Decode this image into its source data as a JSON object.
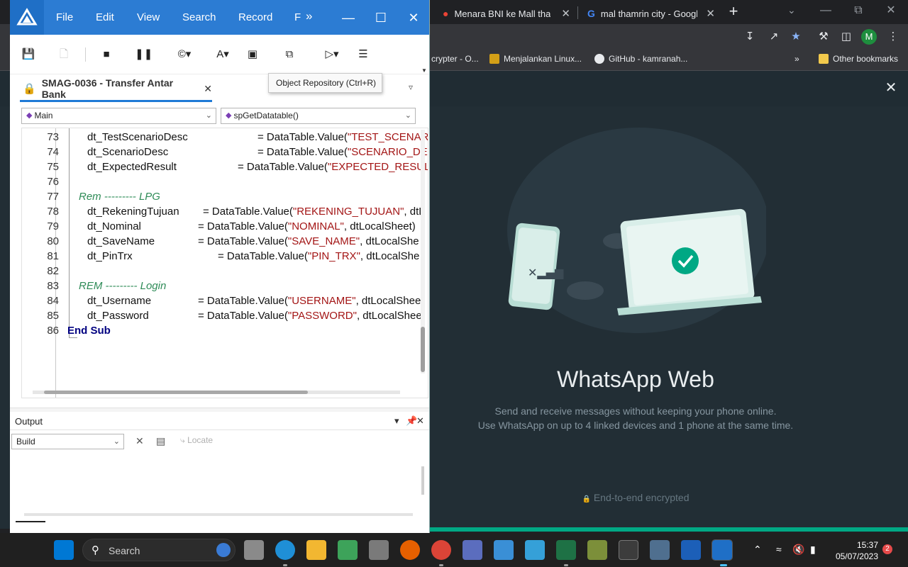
{
  "browser": {
    "tabs": [
      {
        "title": "Menara BNI ke Mall tham",
        "icon": "maps-icon"
      },
      {
        "title": "mal thamrin city - Google",
        "icon": "google-icon"
      }
    ],
    "profile_initial": "M",
    "bookmarks": [
      {
        "label": "crypter - O..."
      },
      {
        "label": "Menjalankan Linux..."
      },
      {
        "label": "GitHub - kamranah..."
      },
      {
        "label": "Other bookmarks"
      }
    ],
    "overflow_label": "»"
  },
  "whatsapp": {
    "title": "WhatsApp Web",
    "line1": "Send and receive messages without keeping your phone online.",
    "line2": "Use WhatsApp on up to 4 linked devices and 1 phone at the same time.",
    "encrypted": "End-to-end encrypted"
  },
  "ide": {
    "menu": [
      "File",
      "Edit",
      "View",
      "Search",
      "Record",
      "F"
    ],
    "tooltip": "Object Repository (Ctrl+R)",
    "doc_tab": "SMAG-0036 - Transfer Antar Bank",
    "scope_combo": "Main",
    "proc_combo": "spGetDatatable()",
    "code_lines": [
      {
        "n": "73",
        "var": "dt_TestScenarioDesc",
        "pad": 346,
        "pre": "= DataTable.Value(",
        "str": "\"TEST_SCENAR",
        "post": ""
      },
      {
        "n": "74",
        "var": "dt_ScenarioDesc",
        "pad": 346,
        "pre": "= DataTable.Value(",
        "str": "\"SCENARIO_DE",
        "post": ""
      },
      {
        "n": "75",
        "var": "dt_ExpectedResult",
        "pad": 318,
        "pre": "= DataTable.Value(",
        "str": "\"EXPECTED_RESULT",
        "post": ""
      },
      {
        "n": "76",
        "blank": true
      },
      {
        "n": "77",
        "comment": "Rem --------- LPG"
      },
      {
        "n": "78",
        "var": "dt_RekeningTujuan",
        "pad": 269,
        "pre": "= DataTable.Value(",
        "str": "\"REKENING_TUJUAN\"",
        "post": ", dtL"
      },
      {
        "n": "79",
        "var": "dt_Nominal",
        "pad": 262,
        "pre": "= DataTable.Value(",
        "str": "\"NOMINAL\"",
        "post": ", dtLocalSheet)"
      },
      {
        "n": "80",
        "var": "dt_SaveName",
        "pad": 262,
        "pre": "= DataTable.Value(",
        "str": "\"SAVE_NAME\"",
        "post": ", dtLocalShe"
      },
      {
        "n": "81",
        "var": "dt_PinTrx",
        "pad": 290,
        "pre": "= DataTable.Value(",
        "str": "\"PIN_TRX\"",
        "post": ", dtLocalShe"
      },
      {
        "n": "82",
        "blank": true
      },
      {
        "n": "83",
        "comment": "REM --------- Login"
      },
      {
        "n": "84",
        "var": "dt_Username",
        "pad": 262,
        "pre": "= DataTable.Value(",
        "str": "\"USERNAME\"",
        "post": ", dtLocalShee"
      },
      {
        "n": "85",
        "var": "dt_Password",
        "pad": 262,
        "pre": "= DataTable.Value(",
        "str": "\"PASSWORD\"",
        "post": ", dtLocalShee"
      },
      {
        "n": "86",
        "keyword": "End Sub"
      }
    ],
    "output_title": "Output",
    "output_combo": "Build",
    "locate_label": "Locate"
  },
  "taskbar": {
    "search_label": "Search",
    "time": "15:37",
    "date": "05/07/2023",
    "notifications": "2"
  },
  "colors": {
    "ide_title": "#2c7cd3",
    "string": "#a31515",
    "comment": "#2e8b57",
    "keyword": "#000080",
    "wa_bg": "#222e35",
    "wa_accent": "#00a884"
  }
}
